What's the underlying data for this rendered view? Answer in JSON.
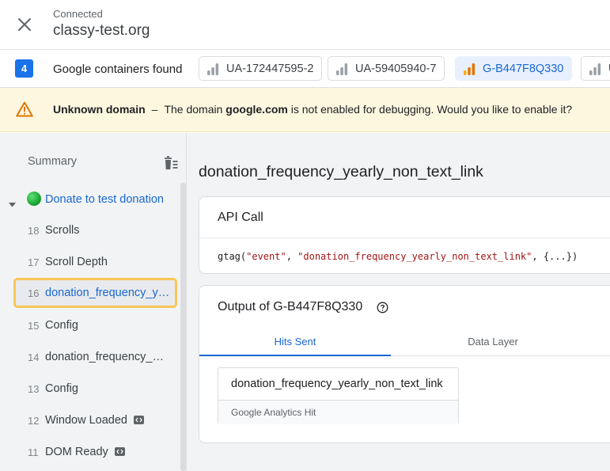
{
  "header": {
    "status": "Connected",
    "domain": "classy-test.org"
  },
  "containers": {
    "count": "4",
    "label": "Google containers found",
    "chips": [
      {
        "id": "UA-172447595-2",
        "active": false
      },
      {
        "id": "UA-59405940-7",
        "active": false
      },
      {
        "id": "G-B447F8Q330",
        "active": true
      },
      {
        "id": "U",
        "active": false
      }
    ]
  },
  "warning": {
    "title": "Unknown domain",
    "separator": "–",
    "text_before": "The domain",
    "domain": "google.com",
    "text_after": "is not enabled for debugging. Would you like to enable it?"
  },
  "sidebar": {
    "summary_label": "Summary",
    "group_label": "Donate to test donation",
    "events": [
      {
        "num": "18",
        "name": "Scrolls",
        "code": false,
        "selected": false
      },
      {
        "num": "17",
        "name": "Scroll Depth",
        "code": false,
        "selected": false
      },
      {
        "num": "16",
        "name": "donation_frequency_yearly_non_text_link",
        "code": false,
        "selected": true
      },
      {
        "num": "15",
        "name": "Config",
        "code": false,
        "selected": false
      },
      {
        "num": "14",
        "name": "donation_frequency_daily_non_text_link",
        "code": false,
        "selected": false
      },
      {
        "num": "13",
        "name": "Config",
        "code": false,
        "selected": false
      },
      {
        "num": "12",
        "name": "Window Loaded",
        "code": true,
        "selected": false
      },
      {
        "num": "11",
        "name": "DOM Ready",
        "code": true,
        "selected": false
      }
    ]
  },
  "main": {
    "event_title": "donation_frequency_yearly_non_text_link",
    "api_card": {
      "title": "API Call",
      "fn": "gtag(",
      "arg1": "\"event\"",
      "sep": ", ",
      "arg2": "\"donation_frequency_yearly_non_text_link\"",
      "rest": ", {...})"
    },
    "output_card": {
      "title": "Output of G-B447F8Q330",
      "tabs": [
        "Hits Sent",
        "Data Layer"
      ],
      "hit": {
        "name": "donation_frequency_yearly_non_text_link",
        "type": "Google Analytics Hit"
      }
    }
  },
  "colors": {
    "accent": "#1a73e8",
    "link": "#1967d2",
    "selection_outline": "#fbc658",
    "warning_bg": "#fef7e0",
    "warning_icon": "#e37400",
    "status_dot": "#1aa533"
  }
}
